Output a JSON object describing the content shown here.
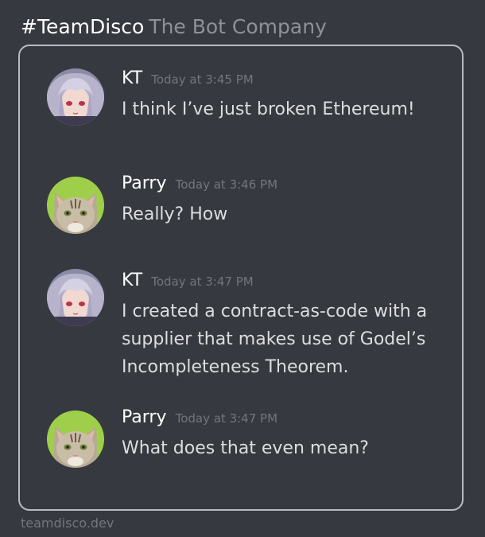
{
  "header": {
    "brand": "#TeamDisco",
    "company": "The Bot Company"
  },
  "messages": [
    {
      "author": "KT",
      "timestamp": "Today at 3:45 PM",
      "text": "I think I’ve just broken Ethereum!",
      "avatar": "anime-girl-avatar"
    },
    {
      "author": "Parry",
      "timestamp": "Today at 3:46 PM",
      "text": "Really?  How",
      "avatar": "cat-avatar"
    },
    {
      "author": "KT",
      "timestamp": "Today at 3:47 PM",
      "text": "I created a contract-as-code with a supplier that makes use of Godel’s Incompleteness Theorem.",
      "avatar": "anime-girl-avatar"
    },
    {
      "author": "Parry",
      "timestamp": "Today at 3:47 PM",
      "text": "What does that even mean?",
      "avatar": "cat-avatar"
    }
  ],
  "footer": {
    "site": "teamdisco.dev"
  },
  "colors": {
    "background": "#36393f",
    "border": "#b9bbbe",
    "author": "#ffffff",
    "timestamp": "#72767d",
    "text": "#dcddde"
  }
}
